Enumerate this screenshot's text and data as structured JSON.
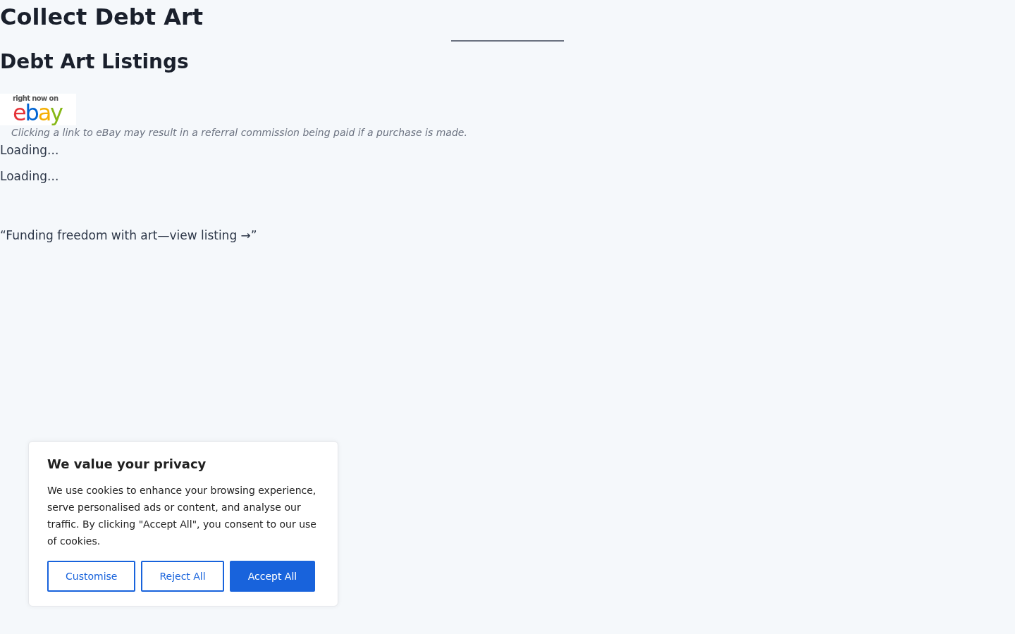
{
  "site_title": "Collect Debt Art",
  "page_heading": "Debt Art Listings",
  "ebay_banner": {
    "tagline": "right now on",
    "wordmark": "ebay"
  },
  "disclaimer": "Clicking a link to eBay may result in a referral commission being paid if a purchase is made.",
  "loading_messages": [
    "Loading...",
    "Loading..."
  ],
  "quote": "“Funding freedom with art—view listing →”",
  "cookie_banner": {
    "title": "We value your privacy",
    "body": "We use cookies to enhance your browsing experience, serve personalised ads or content, and analyse our traffic. By clicking \"Accept All\", you consent to our use of cookies.",
    "buttons": [
      {
        "label": "Customise",
        "kind": "outline"
      },
      {
        "label": "Reject All",
        "kind": "outline"
      },
      {
        "label": "Accept All",
        "kind": "primary"
      }
    ]
  }
}
